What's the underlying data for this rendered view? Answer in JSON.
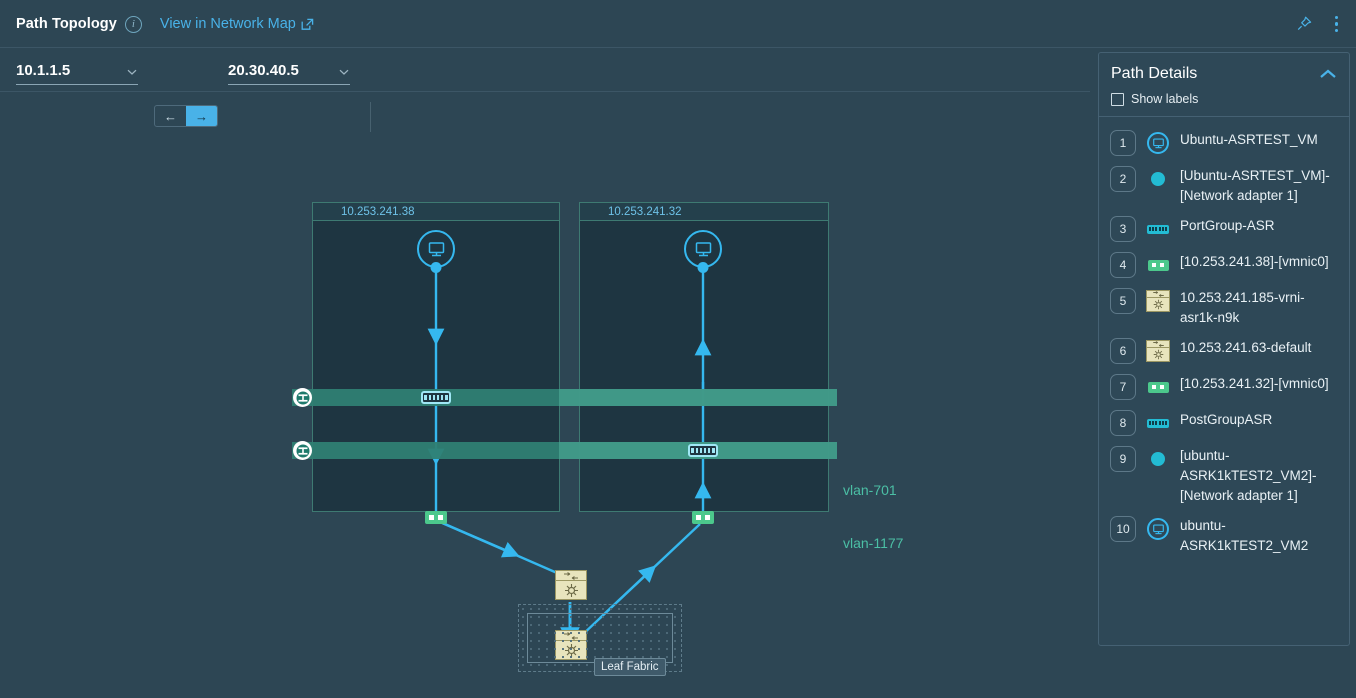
{
  "header": {
    "title": "Path Topology",
    "info_icon": "info-icon",
    "network_map_link": "View in Network Map",
    "external_link_icon": "external-link-icon",
    "pin_icon": "pin-icon",
    "overflow_icon": "kebab-menu-icon"
  },
  "filter": {
    "source_ip": "10.1.1.5",
    "dest_ip": "20.30.40.5",
    "direction_back_label": "←",
    "direction_forward_label": "→",
    "direction_active": "forward"
  },
  "topology": {
    "hosts": [
      {
        "name": "10.253.241.38"
      },
      {
        "name": "10.253.241.32"
      }
    ],
    "vlans": [
      {
        "label": "vlan-701"
      },
      {
        "label": "vlan-1177"
      }
    ],
    "fabric_label": "Leaf Fabric"
  },
  "panel": {
    "title": "Path Details",
    "collapse_icon": "chevron-up-icon",
    "show_labels_label": "Show labels",
    "show_labels_checked": false,
    "hops": [
      {
        "num": "1",
        "icon": "vm-icon",
        "label": "Ubuntu-ASRTEST_VM"
      },
      {
        "num": "2",
        "icon": "adapter-dot-icon",
        "label": "[Ubuntu-ASRTEST_VM]-[Network adapter 1]"
      },
      {
        "num": "3",
        "icon": "portgroup-icon",
        "label": "PortGroup-ASR"
      },
      {
        "num": "4",
        "icon": "vmnic-icon",
        "label": "[10.253.241.38]-[vmnic0]"
      },
      {
        "num": "5",
        "icon": "router-icon",
        "label": "10.253.241.185-vrni-asr1k-n9k"
      },
      {
        "num": "6",
        "icon": "router-icon",
        "label": "10.253.241.63-default"
      },
      {
        "num": "7",
        "icon": "vmnic-icon",
        "label": "[10.253.241.32]-[vmnic0]"
      },
      {
        "num": "8",
        "icon": "portgroup-icon",
        "label": "PostGroupASR"
      },
      {
        "num": "9",
        "icon": "adapter-dot-icon",
        "label": "[ubuntu-ASRK1kTEST2_VM2]-[Network adapter 1]"
      },
      {
        "num": "10",
        "icon": "vm-icon",
        "label": "ubuntu-ASRK1kTEST2_VM2"
      }
    ]
  },
  "colors": {
    "background": "#2d4654",
    "accent": "#49b2e8",
    "link": "#35b8ef",
    "vlan": "#2f8073",
    "vlan_label": "#4bbfa5",
    "nic": "#4cc88c",
    "router": "#e8e4bd",
    "host_fill": "#1e3541"
  }
}
